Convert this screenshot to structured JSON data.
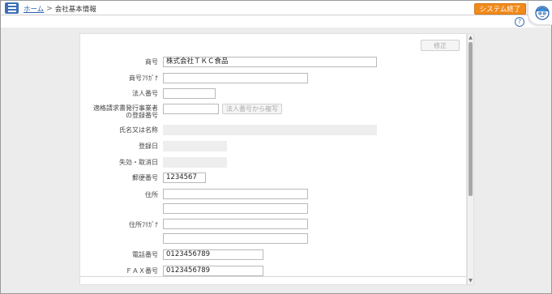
{
  "header": {
    "breadcrumb_home": "ホーム",
    "breadcrumb_sep": ">",
    "breadcrumb_current": "会社基本情報",
    "exit_label": "システム終了",
    "help_label": "?"
  },
  "panel": {
    "edit_label": "修正",
    "fields": {
      "trade_name": {
        "label": "商号",
        "value": "株式会社ＴＫＣ食品"
      },
      "trade_name_kana": {
        "label": "商号ﾌﾘｶﾞﾅ",
        "value": ""
      },
      "corporate_number": {
        "label": "法人番号",
        "value": ""
      },
      "invoice_reg": {
        "label_line1": "適格請求書発行事業者",
        "label_line2": "の登録番号",
        "value": "",
        "fetch_label": "法人番号から複写"
      },
      "name": {
        "label": "氏名又は名称",
        "value": ""
      },
      "reg_date": {
        "label": "登録日",
        "value": ""
      },
      "expire_date": {
        "label": "失効・取消日",
        "value": ""
      },
      "postal": {
        "label": "郵便番号",
        "value": "1234567"
      },
      "address": {
        "label": "住所",
        "value1": "",
        "value2": ""
      },
      "address_kana": {
        "label": "住所ﾌﾘｶﾞﾅ",
        "value1": "",
        "value2": ""
      },
      "phone": {
        "label": "電話番号",
        "value": "0123456789"
      },
      "fax": {
        "label": "ＦＡＸ番号",
        "value": "0123456789"
      }
    }
  },
  "colors": {
    "accent": "#3d6fb6",
    "exit_button": "#f08a1c"
  }
}
